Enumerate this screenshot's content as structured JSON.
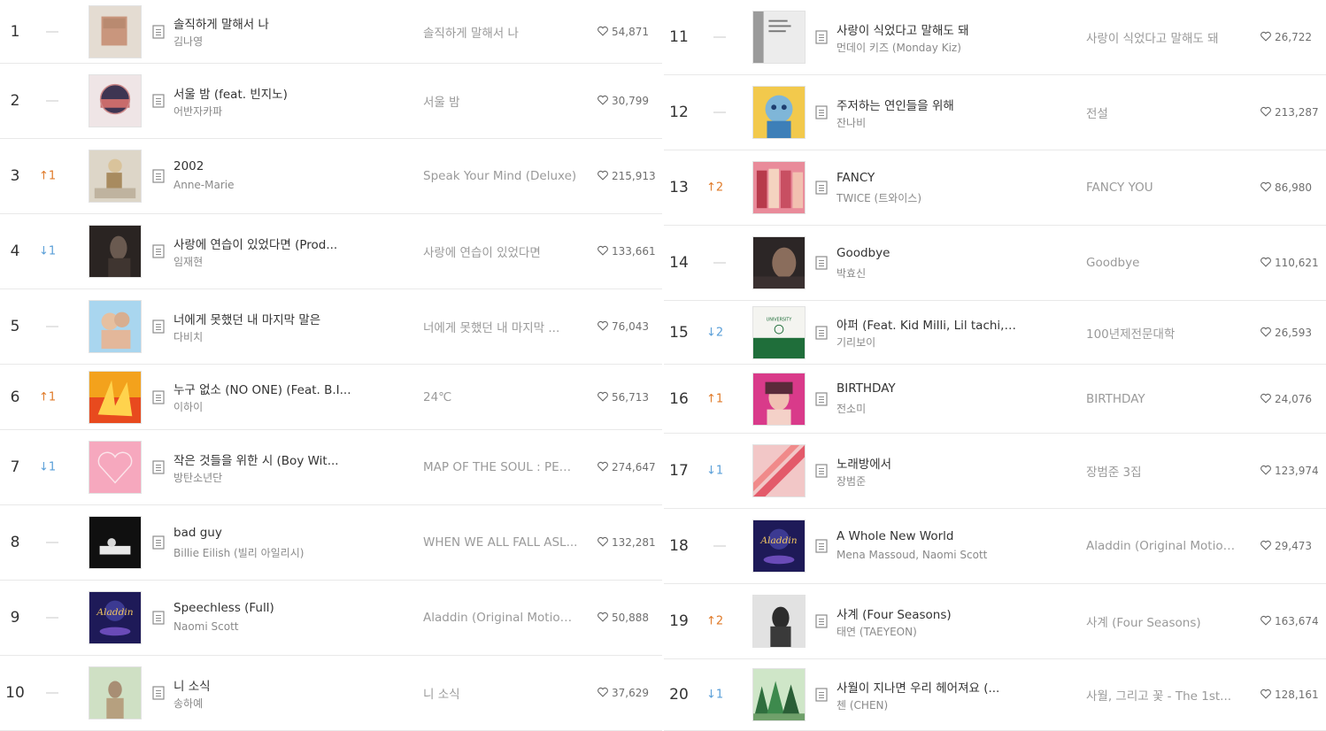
{
  "left_rows": [
    {
      "rank": "1",
      "change_dir": "same",
      "change": "",
      "title": "솔직하게 말해서 나",
      "artist": "김나영",
      "album": "솔직하게 말해서 나",
      "likes": "54,871",
      "art": "a1"
    },
    {
      "rank": "2",
      "change_dir": "same",
      "change": "",
      "title": "서울 밤 (feat. 빈지노)",
      "artist": "어반자카파",
      "album": "서울 밤",
      "likes": "30,799",
      "art": "a2"
    },
    {
      "rank": "3",
      "change_dir": "up",
      "change": "1",
      "title": "2002",
      "artist": "Anne-Marie",
      "album": "Speak Your Mind (Deluxe)",
      "likes": "215,913",
      "art": "a3"
    },
    {
      "rank": "4",
      "change_dir": "down",
      "change": "1",
      "title": "사랑에 연습이 있었다면 (Prod...",
      "artist": "임재현",
      "album": "사랑에 연습이 있었다면",
      "likes": "133,661",
      "art": "a4"
    },
    {
      "rank": "5",
      "change_dir": "same",
      "change": "",
      "title": "너에게 못했던 내 마지막 말은",
      "artist": "다비치",
      "album": "너에게 못했던 내 마지막 ...",
      "likes": "76,043",
      "art": "a5"
    },
    {
      "rank": "6",
      "change_dir": "up",
      "change": "1",
      "title": "누구 없소 (NO ONE) (Feat. B.I...",
      "artist": "이하이",
      "album": "24℃",
      "likes": "56,713",
      "art": "a6"
    },
    {
      "rank": "7",
      "change_dir": "down",
      "change": "1",
      "title": "작은 것들을 위한 시 (Boy Wit...",
      "artist": "방탄소년단",
      "album": "MAP OF THE SOUL : PER...",
      "likes": "274,647",
      "art": "a7"
    },
    {
      "rank": "8",
      "change_dir": "same",
      "change": "",
      "title": "bad guy",
      "artist": "Billie Eilish (빌리 아일리시)",
      "album": "WHEN WE ALL FALL ASL...",
      "likes": "132,281",
      "art": "a8"
    },
    {
      "rank": "9",
      "change_dir": "same",
      "change": "",
      "title": "Speechless (Full)",
      "artist": "Naomi Scott",
      "album": "Aladdin (Original Motion...",
      "likes": "50,888",
      "art": "a9"
    },
    {
      "rank": "10",
      "change_dir": "same",
      "change": "",
      "title": "니 소식",
      "artist": "송하예",
      "album": "니 소식",
      "likes": "37,629",
      "art": "a10"
    }
  ],
  "right_rows": [
    {
      "rank": "11",
      "change_dir": "same",
      "change": "",
      "title": "사랑이 식었다고 말해도 돼",
      "artist": "먼데이 키즈 (Monday Kiz)",
      "album": "사랑이 식었다고 말해도 돼",
      "likes": "26,722",
      "art": "b11"
    },
    {
      "rank": "12",
      "change_dir": "same",
      "change": "",
      "title": "주저하는 연인들을 위해",
      "artist": "잔나비",
      "album": "전설",
      "likes": "213,287",
      "art": "b12"
    },
    {
      "rank": "13",
      "change_dir": "up",
      "change": "2",
      "title": "FANCY",
      "artist": "TWICE (트와이스)",
      "album": "FANCY YOU",
      "likes": "86,980",
      "art": "b13"
    },
    {
      "rank": "14",
      "change_dir": "same",
      "change": "",
      "title": "Goodbye",
      "artist": "박효신",
      "album": "Goodbye",
      "likes": "110,621",
      "art": "b14"
    },
    {
      "rank": "15",
      "change_dir": "down",
      "change": "2",
      "title": "아퍼 (Feat. Kid Milli, Lil tachi, ...",
      "artist": "기리보이",
      "album": "100년제전문대학",
      "likes": "26,593",
      "art": "b15"
    },
    {
      "rank": "16",
      "change_dir": "up",
      "change": "1",
      "title": "BIRTHDAY",
      "artist": "전소미",
      "album": "BIRTHDAY",
      "likes": "24,076",
      "art": "b16"
    },
    {
      "rank": "17",
      "change_dir": "down",
      "change": "1",
      "title": "노래방에서",
      "artist": "장범준",
      "album": "장범준 3집",
      "likes": "123,974",
      "art": "b17"
    },
    {
      "rank": "18",
      "change_dir": "same",
      "change": "",
      "title": "A Whole New World",
      "artist": "Mena Massoud, Naomi Scott",
      "album": "Aladdin (Original Motion...",
      "likes": "29,473",
      "art": "b18"
    },
    {
      "rank": "19",
      "change_dir": "up",
      "change": "2",
      "title": "사계 (Four Seasons)",
      "artist": "태연 (TAEYEON)",
      "album": "사계 (Four Seasons)",
      "likes": "163,674",
      "art": "b19"
    },
    {
      "rank": "20",
      "change_dir": "down",
      "change": "1",
      "title": "사월이 지나면 우리 헤어져요 (...",
      "artist": "첸 (CHEN)",
      "album": "사월, 그리고 꽃 - The 1st...",
      "likes": "128,161",
      "art": "b20"
    }
  ],
  "colors": {
    "up": "#e07b2a",
    "down": "#5a9fd8",
    "same": "#c8c8c8"
  }
}
